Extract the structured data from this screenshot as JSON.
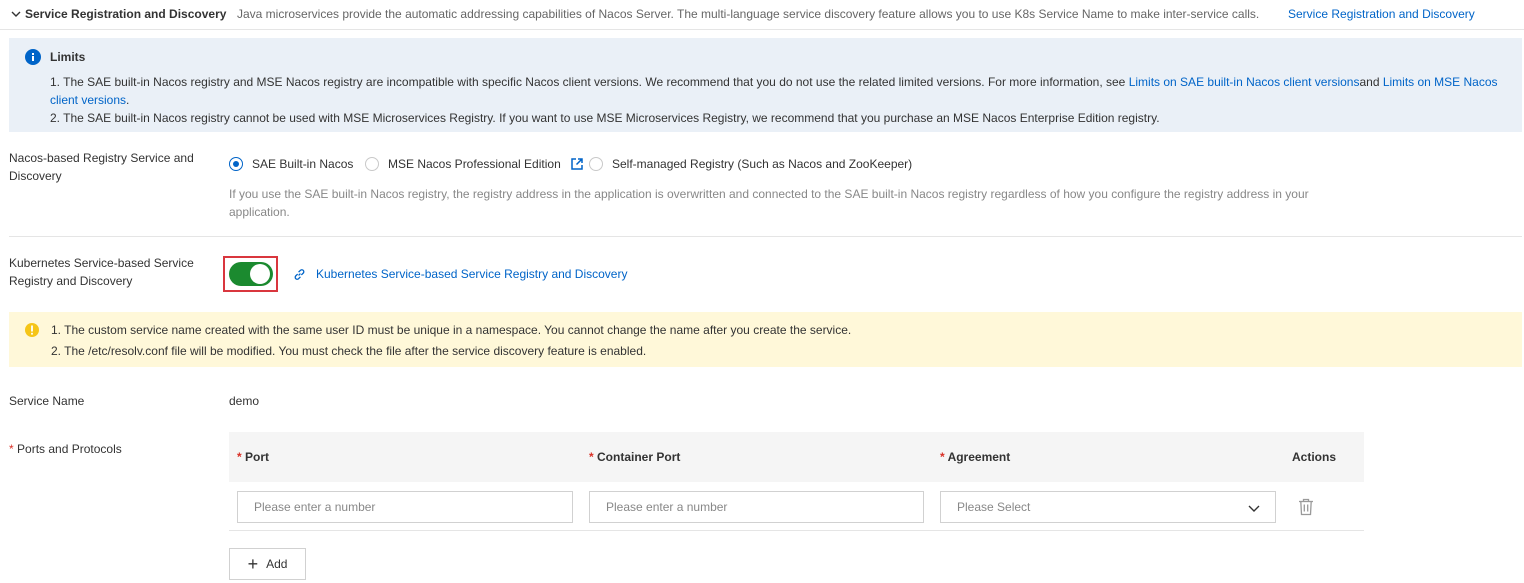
{
  "header": {
    "title": "Service Registration and Discovery",
    "description": "Java microservices provide the automatic addressing capabilities of Nacos Server. The multi-language service discovery feature allows you to use K8s Service Name to make inter-service calls.",
    "link": "Service Registration and Discovery"
  },
  "limits": {
    "title": "Limits",
    "line1_prefix": "1. The SAE built-in Nacos registry and MSE Nacos registry are incompatible with specific Nacos client versions. We recommend that you do not use the related limited versions. For more information, see ",
    "line1_link1": "Limits on SAE built-in Nacos client versions",
    "line1_mid": "and ",
    "line1_link2": "Limits on MSE Nacos client versions",
    "line1_suffix": ".",
    "line2": "2. The SAE built-in Nacos registry cannot be used with MSE Microservices Registry. If you want to use MSE Microservices Registry, we recommend that you purchase an MSE Nacos Enterprise Edition registry."
  },
  "nacos": {
    "label": "Nacos-based Registry Service and Discovery",
    "options": [
      "SAE Built-in Nacos",
      "MSE Nacos Professional Edition",
      "Self-managed Registry (Such as Nacos and ZooKeeper)"
    ],
    "selected": "SAE Built-in Nacos",
    "help": "If you use the SAE built-in Nacos registry, the registry address in the application is overwritten and connected to the SAE built-in Nacos registry regardless of how you configure the registry address in your application."
  },
  "k8s": {
    "label": "Kubernetes Service-based Service Registry and Discovery",
    "enabled": true,
    "link": "Kubernetes Service-based Service Registry and Discovery"
  },
  "warning": {
    "line1": "1. The custom service name created with the same user ID must be unique in a namespace. You cannot change the name after you create the service.",
    "line2": "2. The /etc/resolv.conf file will be modified. You must check the file after the service discovery feature is enabled."
  },
  "service_name": {
    "label": "Service Name",
    "value": "demo"
  },
  "ports": {
    "required_mark": "*",
    "label": "Ports and Protocols",
    "columns": {
      "port": "Port",
      "container_port": "Container Port",
      "agreement": "Agreement",
      "actions": "Actions"
    },
    "row": {
      "port_placeholder": "Please enter a number",
      "container_port_placeholder": "Please enter a number",
      "agreement_placeholder": "Please Select"
    },
    "add_label": "Add"
  },
  "colors": {
    "link": "#0064c8",
    "toggle_on": "#1b8a2f",
    "highlight_frame": "#d9363e",
    "info_bg": "#eaf0f7",
    "warning_bg": "#fff8d9",
    "required": "#d93026"
  }
}
